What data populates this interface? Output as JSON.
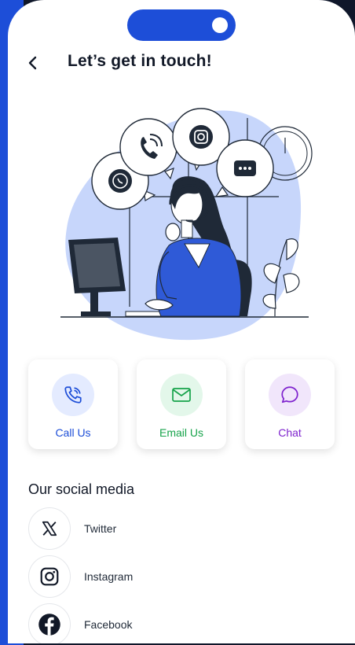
{
  "header": {
    "title": "Let’s get in touch!"
  },
  "contact_cards": [
    {
      "label": "Call Us",
      "color": "#1d4ed8",
      "bg": "#e4ebff",
      "icon": "phone-icon"
    },
    {
      "label": "Email Us",
      "color": "#16a34a",
      "bg": "#e3f7ea",
      "icon": "mail-icon"
    },
    {
      "label": "Chat",
      "color": "#7e22ce",
      "bg": "#f1e6fb",
      "icon": "chat-icon"
    }
  ],
  "social": {
    "title": "Our social media",
    "items": [
      {
        "name": "Twitter",
        "icon": "x-logo-icon"
      },
      {
        "name": "Instagram",
        "icon": "instagram-icon"
      },
      {
        "name": "Facebook",
        "icon": "facebook-icon"
      }
    ]
  },
  "colors": {
    "accent": "#1d4ed8",
    "illustration_bg": "#c7d6fb"
  }
}
